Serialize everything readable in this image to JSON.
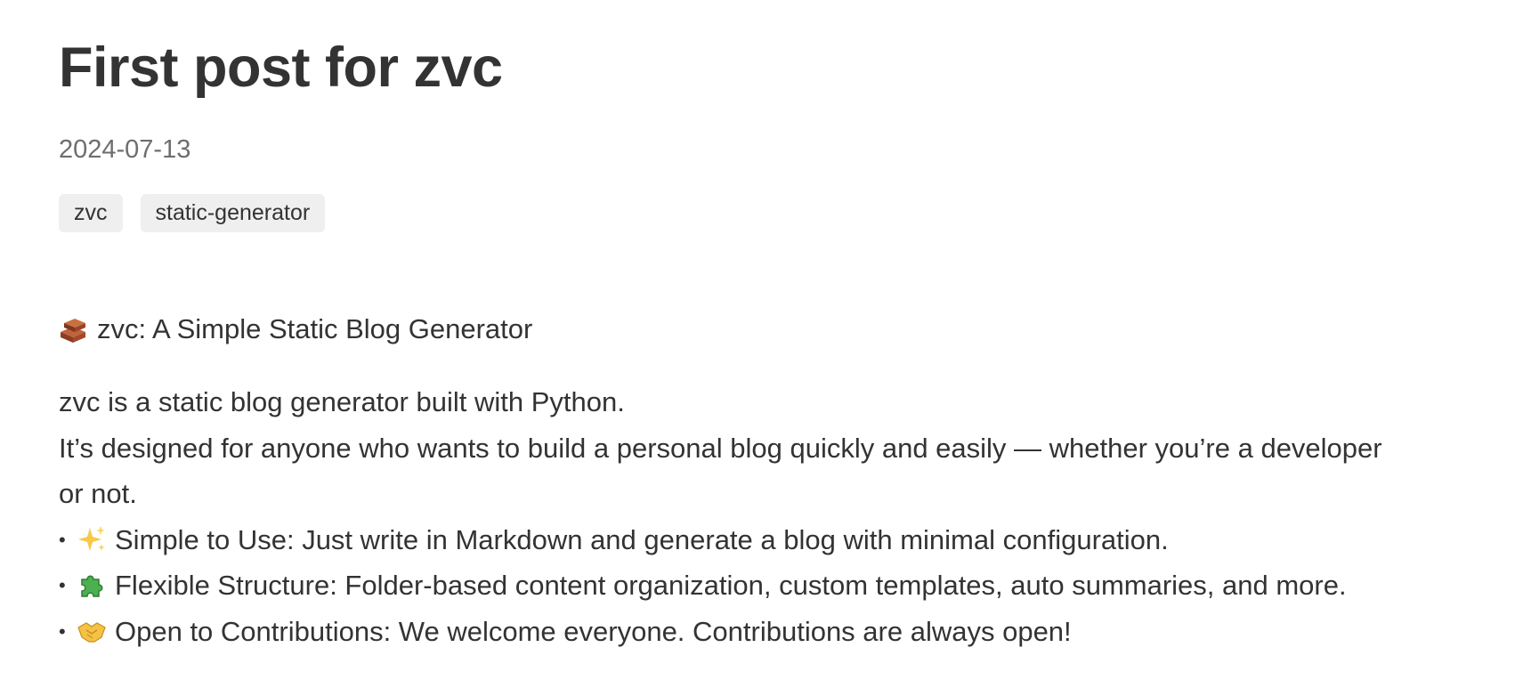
{
  "post": {
    "title": "First post for zvc",
    "date": "2024-07-13",
    "tags": [
      "zvc",
      "static-generator"
    ]
  },
  "content": {
    "heading": {
      "icon": "bricks-icon",
      "text": "zvc: A Simple Static Blog Generator"
    },
    "intro_lines": [
      "zvc is a static blog generator built with Python.",
      "It’s designed for anyone who wants to build a personal blog quickly and easily — whether you’re a developer",
      "or not."
    ],
    "bullet_symbol": "•",
    "features": [
      {
        "icon": "sparkles-icon",
        "text": "Simple to Use: Just write in Markdown and generate a blog with minimal configuration."
      },
      {
        "icon": "puzzle-piece-icon",
        "text": "Flexible Structure: Folder-based content organization, custom templates, auto summaries, and more."
      },
      {
        "icon": "handshake-icon",
        "text": "Open to Contributions: We welcome everyone. Contributions are always open!"
      }
    ]
  },
  "colors": {
    "text": "#333333",
    "date": "#6e6e6e",
    "tag_background": "#efefef"
  }
}
